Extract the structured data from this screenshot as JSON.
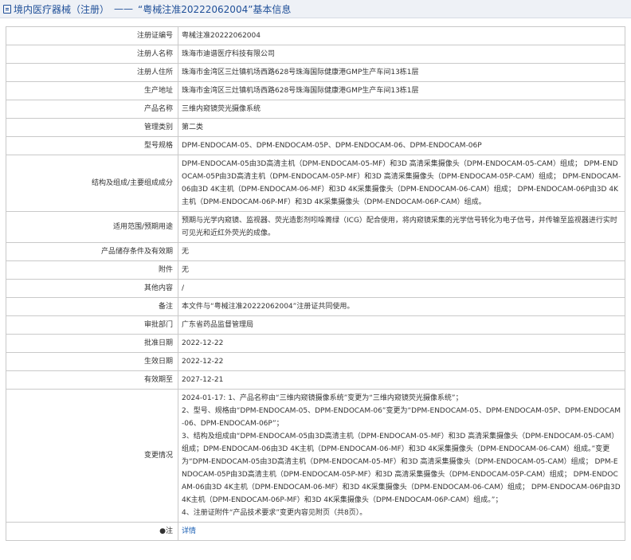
{
  "header": {
    "crumb": "境内医疗器械（注册）",
    "separator": "——",
    "title": "“粤械注准20222062004”基本信息"
  },
  "rows": [
    {
      "label": "注册证编号",
      "value": "粤械注准20222062004"
    },
    {
      "label": "注册人名称",
      "value": "珠海市迪谱医疗科技有限公司"
    },
    {
      "label": "注册人住所",
      "value": "珠海市金湾区三灶镇机场西路628号珠海国际健康港GMP生产车间13栋1层"
    },
    {
      "label": "生产地址",
      "value": "珠海市金湾区三灶镇机场西路628号珠海国际健康港GMP生产车间13栋1层"
    },
    {
      "label": "产品名称",
      "value": "三维内窥镜荧光摄像系统"
    },
    {
      "label": "管理类别",
      "value": "第二类"
    },
    {
      "label": "型号规格",
      "value": "DPM-ENDOCAM-05、DPM-ENDOCAM-05P、DPM-ENDOCAM-06、DPM-ENDOCAM-06P"
    },
    {
      "label": "结构及组成/主要组成成分",
      "value": "DPM-ENDOCAM-05由3D高清主机（DPM-ENDOCAM-05-MF）和3D 高清采集摄像头（DPM-ENDOCAM-05-CAM）组成； DPM-ENDOCAM-05P由3D高清主机（DPM-ENDOCAM-05P-MF）和3D 高清采集摄像头（DPM-ENDOCAM-05P-CAM）组成； DPM-ENDOCAM-06由3D 4K主机（DPM-ENDOCAM-06-MF）和3D 4K采集摄像头（DPM-ENDOCAM-06-CAM）组成； DPM-ENDOCAM-06P由3D 4K主机（DPM-ENDOCAM-06P-MF）和3D 4K采集摄像头（DPM-ENDOCAM-06P-CAM）组成。"
    },
    {
      "label": "适用范围/预期用途",
      "value": "预期与光学内窥镜、监视器、荧光造影剂吲哚菁绿（ICG）配合使用，将内窥镜采集的光学信号转化为电子信号，并传输至监视器进行实时可见光和近红外荧光的成像。"
    },
    {
      "label": "产品储存条件及有效期",
      "value": "无"
    },
    {
      "label": "附件",
      "value": "无"
    },
    {
      "label": "其他内容",
      "value": "/"
    },
    {
      "label": "备注",
      "value": "本文件与“粤械注准20222062004”注册证共同使用。"
    },
    {
      "label": "审批部门",
      "value": "广东省药品监督管理局"
    },
    {
      "label": "批准日期",
      "value": "2022-12-22"
    },
    {
      "label": "生效日期",
      "value": "2022-12-22"
    },
    {
      "label": "有效期至",
      "value": "2027-12-21"
    }
  ],
  "changes": {
    "label": "变更情况",
    "lines": [
      "2024-01-17: 1、产品名称由“三维内窥镜摄像系统”变更为“三维内窥镜荧光摄像系统”；",
      "2、型号、规格由“DPM-ENDOCAM-05、DPM-ENDOCAM-06”变更为“DPM-ENDOCAM-05、DPM-ENDOCAM-05P、DPM-ENDOCAM-06、DPM-ENDOCAM-06P”；",
      "3、结构及组成由“DPM-ENDOCAM-05由3D高清主机（DPM-ENDOCAM-05-MF）和3D 高清采集摄像头（DPM-ENDOCAM-05-CAM）组成；DPM-ENDOCAM-06由3D 4K主机（DPM-ENDOCAM-06-MF）和3D 4K采集摄像头（DPM-ENDOCAM-06-CAM）组成。”变更为“DPM-ENDOCAM-05由3D高清主机（DPM-ENDOCAM-05-MF）和3D 高清采集摄像头（DPM-ENDOCAM-05-CAM）组成； DPM-ENDOCAM-05P由3D高清主机（DPM-ENDOCAM-05P-MF）和3D 高清采集摄像头（DPM-ENDOCAM-05P-CAM）组成； DPM-ENDOCAM-06由3D 4K主机（DPM-ENDOCAM-06-MF）和3D 4K采集摄像头（DPM-ENDOCAM-06-CAM）组成； DPM-ENDOCAM-06P由3D 4K主机（DPM-ENDOCAM-06P-MF）和3D 4K采集摄像头（DPM-ENDOCAM-06P-CAM）组成。”；",
      "4、注册证附件“产品技术要求”变更内容见附页（共8页）。"
    ]
  },
  "note": {
    "label": "注",
    "marker": "●",
    "link": "详情"
  }
}
